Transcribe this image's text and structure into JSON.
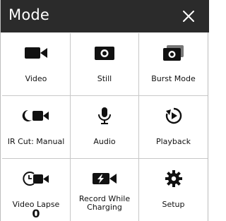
{
  "header": {
    "title": "Mode",
    "close_label": "✕"
  },
  "modes": [
    {
      "label": "Video",
      "icon": "video-camera-icon"
    },
    {
      "label": "Still",
      "icon": "still-camera-icon"
    },
    {
      "label": "Burst Mode",
      "icon": "burst-mode-icon"
    },
    {
      "label": "IR Cut: Manual",
      "icon": "ir-cut-icon"
    },
    {
      "label": "Audio",
      "icon": "microphone-icon"
    },
    {
      "label": "Playback",
      "icon": "playback-icon"
    },
    {
      "label": "Video Lapse",
      "icon": "video-lapse-icon",
      "sub": "0"
    },
    {
      "label": "Record While Charging",
      "icon": "record-while-charging-icon"
    },
    {
      "label": "Setup",
      "icon": "gear-icon"
    }
  ]
}
